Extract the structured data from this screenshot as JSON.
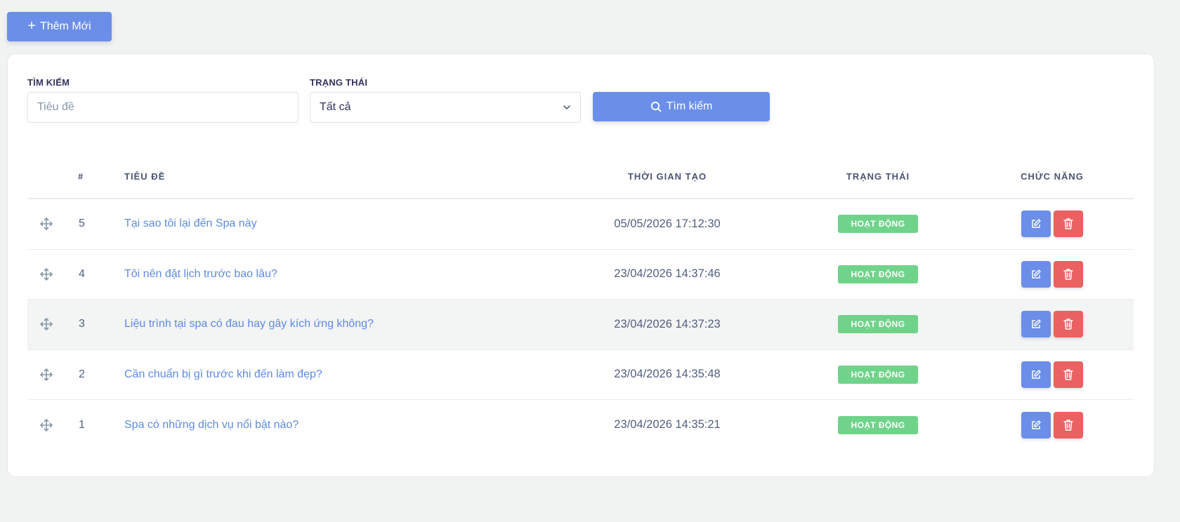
{
  "toolbar": {
    "add_label": "Thêm Mới"
  },
  "filters": {
    "search_label": "TÌM KIẾM",
    "search_placeholder": "Tiêu đề",
    "status_label": "TRẠNG THÁI",
    "status_value": "Tất cả",
    "search_button": "Tìm kiếm"
  },
  "table": {
    "columns": {
      "num": "#",
      "title": "TIÊU ĐỀ",
      "created": "THỜI GIAN TẠO",
      "status": "TRẠNG THÁI",
      "actions": "CHỨC NĂNG"
    },
    "rows": [
      {
        "num": "5",
        "title": "Tại sao tôi lại đến Spa này",
        "created": "05/05/2026 17:12:30",
        "status": "HOẠT ĐỘNG"
      },
      {
        "num": "4",
        "title": "Tôi nên đặt lịch trước bao lâu?",
        "created": "23/04/2026 14:37:46",
        "status": "HOẠT ĐỘNG"
      },
      {
        "num": "3",
        "title": "Liệu trình tại spa có đau hay gây kích ứng không?",
        "created": "23/04/2026 14:37:23",
        "status": "HOẠT ĐỘNG"
      },
      {
        "num": "2",
        "title": "Cần chuẩn bị gì trước khi đến làm đẹp?",
        "created": "23/04/2026 14:35:48",
        "status": "HOẠT ĐỘNG"
      },
      {
        "num": "1",
        "title": "Spa có những dịch vụ nổi bật nào?",
        "created": "23/04/2026 14:35:21",
        "status": "HOẠT ĐỘNG"
      }
    ]
  },
  "colors": {
    "primary": "#6b8fe8",
    "success": "#6fd38a",
    "danger": "#ea6161",
    "link": "#5e8be0"
  },
  "icons": {
    "add": "plus-icon",
    "search": "search-icon",
    "dropdown": "chevron-down-icon",
    "drag": "move-icon",
    "edit": "edit-icon",
    "delete": "trash-icon"
  }
}
